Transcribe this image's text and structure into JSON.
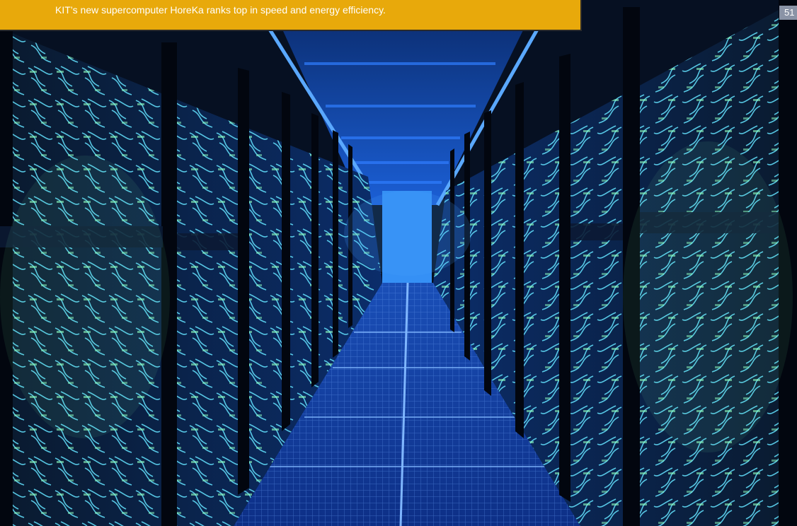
{
  "caption": {
    "text": "KIT’s new supercomputer HoreKa ranks top in speed and energy efficiency."
  },
  "page_number": {
    "text": "51"
  },
  "colors": {
    "banner": "#e8a90b",
    "page_number_bg": "#8a93a6",
    "accent_blue": "#1e6fff",
    "cable_cyan": "#5fe6ff",
    "cable_green": "#7dffb0"
  },
  "photo": {
    "subject": "data-center-aisle",
    "icon": "server-racks-photo"
  }
}
